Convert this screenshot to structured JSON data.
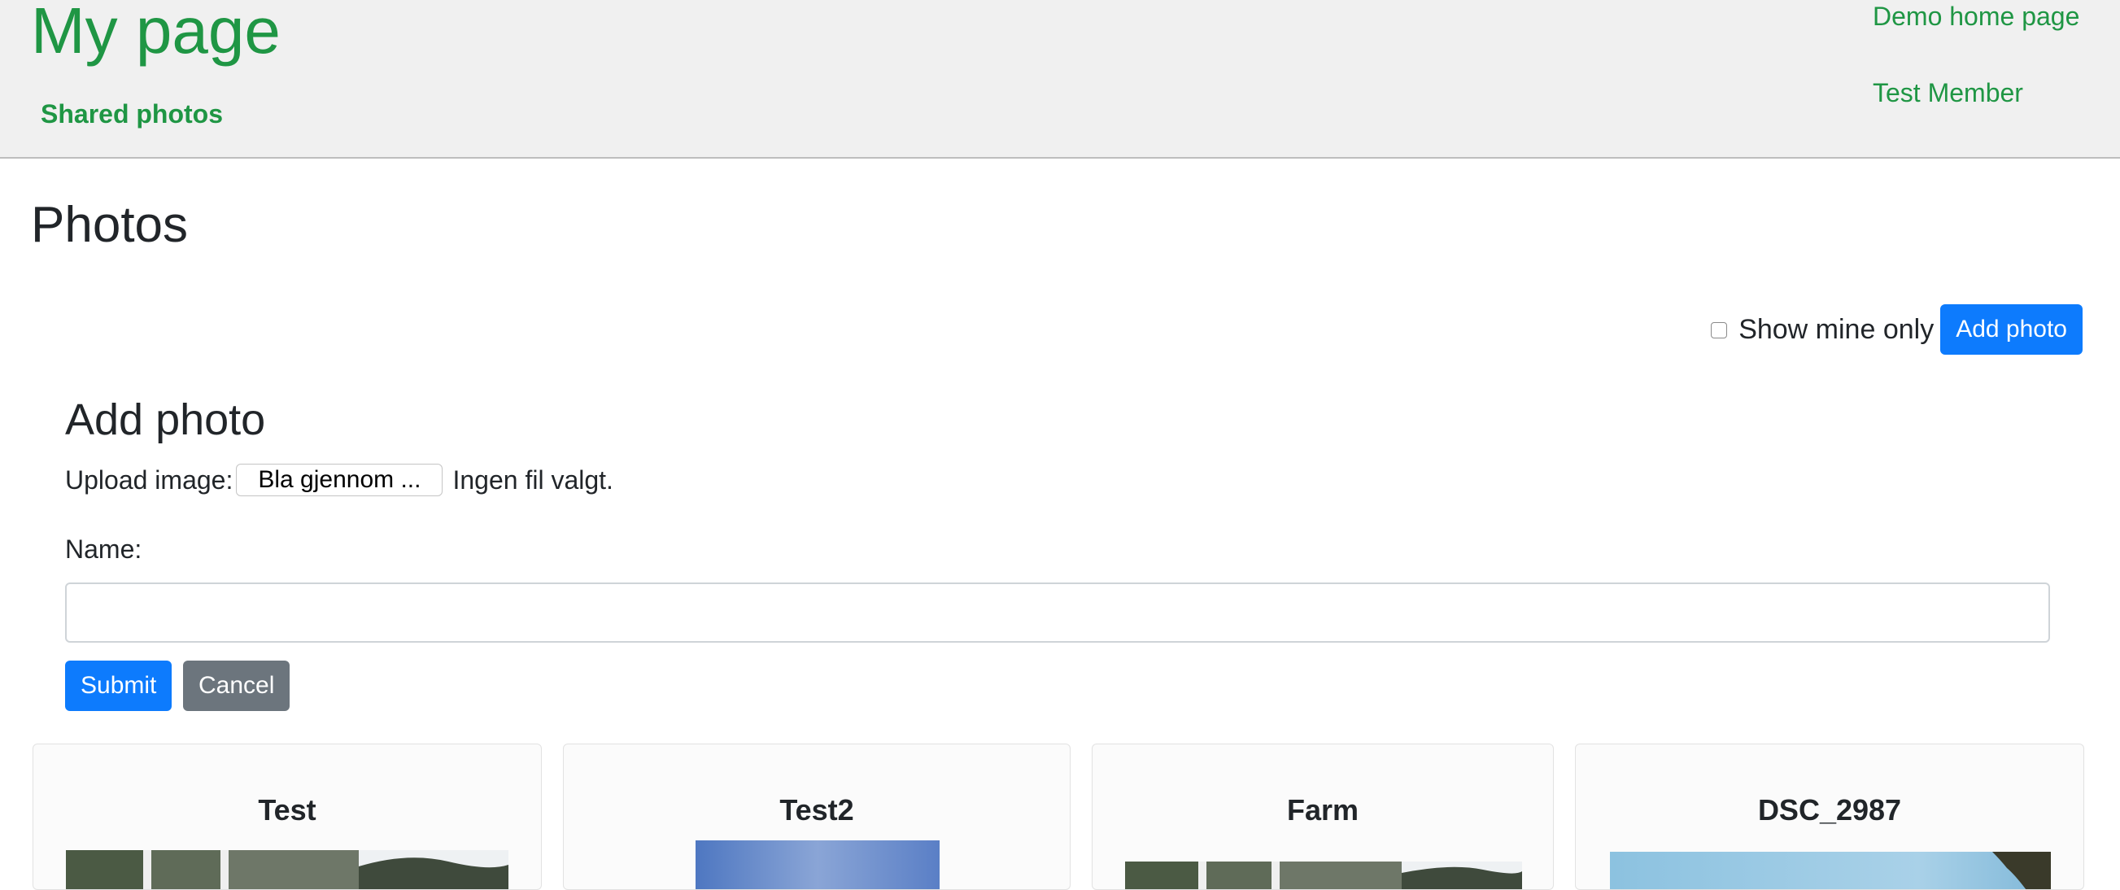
{
  "header": {
    "site_title": "My page",
    "shared_photos": "Shared photos",
    "demo_home": "Demo home page",
    "member": "Test Member"
  },
  "main": {
    "title": "Photos",
    "show_mine_only": "Show mine only",
    "add_photo_button": "Add photo"
  },
  "form": {
    "title": "Add photo",
    "upload_label": "Upload image:",
    "browse_button": "Bla gjennom ...",
    "file_status": "Ingen fil valgt.",
    "name_label": "Name:",
    "name_value": "",
    "submit": "Submit",
    "cancel": "Cancel"
  },
  "photos": [
    {
      "name": "Test"
    },
    {
      "name": "Test2"
    },
    {
      "name": "Farm"
    },
    {
      "name": "DSC_2987"
    }
  ],
  "colors": {
    "brand_green": "#1f9644",
    "primary": "#0d7bfd",
    "secondary": "#6c757d",
    "header_bg": "#f0f0f0"
  }
}
